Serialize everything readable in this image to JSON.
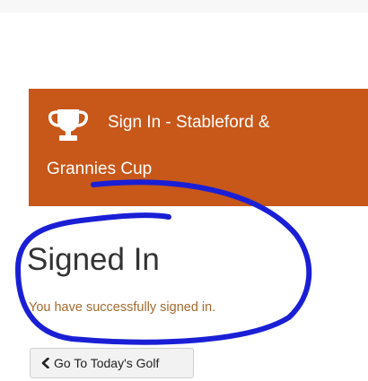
{
  "banner": {
    "icon": "trophy-icon",
    "background_color": "#c8571a",
    "title_line1": "Sign In - Stableford &",
    "title_line2": "Grannies Cup"
  },
  "main": {
    "heading": "Signed In",
    "message": "You have successfully signed in.",
    "message_color": "#a36a2e"
  },
  "actions": {
    "back_icon": "chevron-left-icon",
    "back_label": "Go To Today's Golf"
  },
  "annotation": {
    "type": "hand-drawn-circle",
    "color": "#1a1fd6"
  }
}
